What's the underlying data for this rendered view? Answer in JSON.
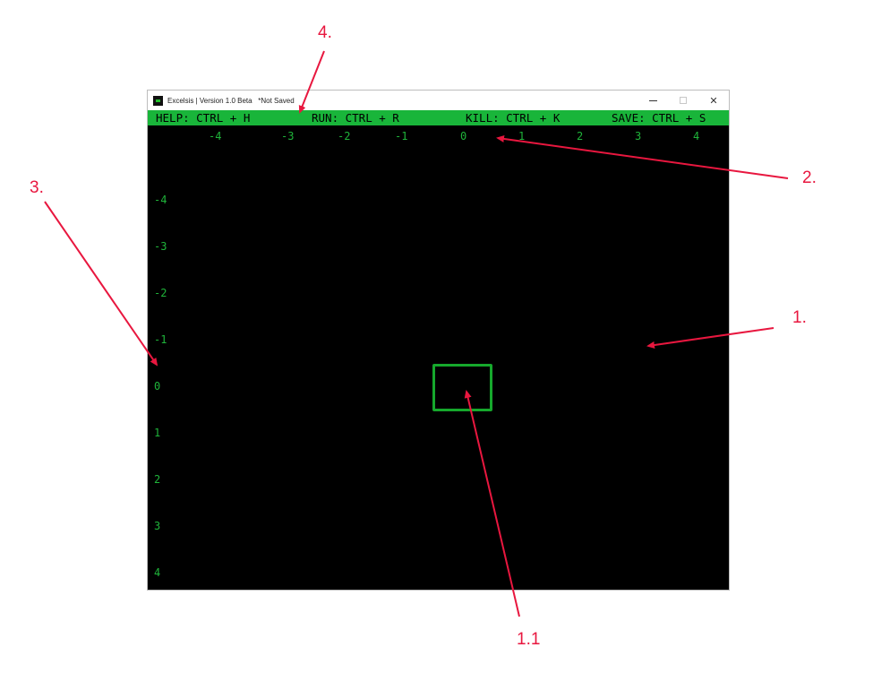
{
  "window": {
    "title": "Excelsis | Version 1.0 Beta   *Not Saved",
    "controls": {
      "minimize": "–",
      "maximize": "□",
      "close": "✕"
    }
  },
  "menubar": {
    "help": "HELP: CTRL + H",
    "run": "RUN: CTRL + R",
    "kill": "KILL: CTRL + K",
    "save": "SAVE: CTRL + S"
  },
  "grid": {
    "x_labels": [
      "-4",
      "-3",
      "-2",
      "-1",
      "0",
      "1",
      "2",
      "3",
      "4"
    ],
    "y_labels": [
      "-4",
      "-3",
      "-2",
      "-1",
      "0",
      "1",
      "2",
      "3",
      "4"
    ]
  },
  "annotations": {
    "a1": "1.",
    "a1_1": "1.1",
    "a2": "2.",
    "a3": "3.",
    "a4": "4."
  },
  "colors": {
    "accent_green": "#19b53a",
    "label_green": "#1fb43a",
    "annotation_red": "#e8173f",
    "canvas_bg": "#000000"
  }
}
